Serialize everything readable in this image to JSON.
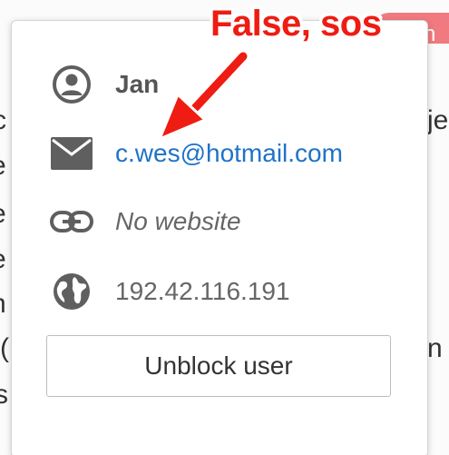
{
  "background": {
    "pill_text": "n",
    "left_fragments": [
      "c",
      "e",
      "e",
      "e",
      "n",
      "(",
      "s"
    ],
    "right_fragments": [
      "je",
      "n"
    ]
  },
  "popover": {
    "name": "Jan",
    "email": "c.wes@hotmail.com",
    "website": "No website",
    "ip": "192.42.116.191",
    "unblock_label": "Unblock user"
  },
  "annotation": {
    "text": "False, sos"
  },
  "icons": {
    "name": "user-icon",
    "email": "envelope-icon",
    "website": "link-icon",
    "ip": "globe-icon"
  },
  "colors": {
    "email_link": "#1f72c8",
    "annotation": "#ee1c12",
    "icon": "#5f5f5f"
  }
}
